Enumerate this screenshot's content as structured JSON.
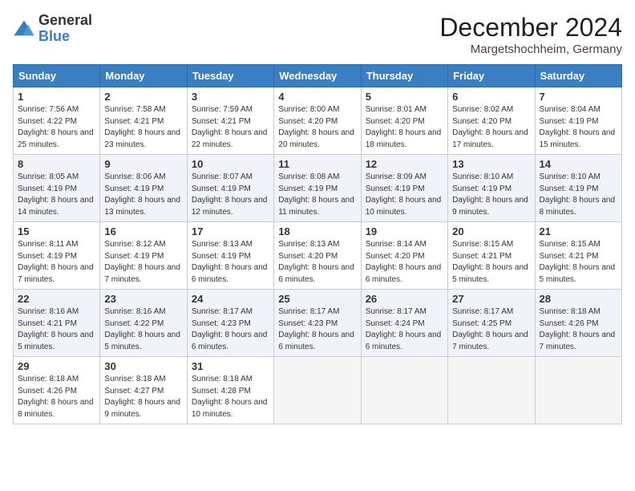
{
  "header": {
    "logo": {
      "general": "General",
      "blue": "Blue"
    },
    "title": "December 2024",
    "location": "Margetshochheim, Germany"
  },
  "days_of_week": [
    "Sunday",
    "Monday",
    "Tuesday",
    "Wednesday",
    "Thursday",
    "Friday",
    "Saturday"
  ],
  "weeks": [
    [
      {
        "num": "1",
        "sunrise": "7:56 AM",
        "sunset": "4:22 PM",
        "daylight": "8 hours and 25 minutes."
      },
      {
        "num": "2",
        "sunrise": "7:58 AM",
        "sunset": "4:21 PM",
        "daylight": "8 hours and 23 minutes."
      },
      {
        "num": "3",
        "sunrise": "7:59 AM",
        "sunset": "4:21 PM",
        "daylight": "8 hours and 22 minutes."
      },
      {
        "num": "4",
        "sunrise": "8:00 AM",
        "sunset": "4:20 PM",
        "daylight": "8 hours and 20 minutes."
      },
      {
        "num": "5",
        "sunrise": "8:01 AM",
        "sunset": "4:20 PM",
        "daylight": "8 hours and 18 minutes."
      },
      {
        "num": "6",
        "sunrise": "8:02 AM",
        "sunset": "4:20 PM",
        "daylight": "8 hours and 17 minutes."
      },
      {
        "num": "7",
        "sunrise": "8:04 AM",
        "sunset": "4:19 PM",
        "daylight": "8 hours and 15 minutes."
      }
    ],
    [
      {
        "num": "8",
        "sunrise": "8:05 AM",
        "sunset": "4:19 PM",
        "daylight": "8 hours and 14 minutes."
      },
      {
        "num": "9",
        "sunrise": "8:06 AM",
        "sunset": "4:19 PM",
        "daylight": "8 hours and 13 minutes."
      },
      {
        "num": "10",
        "sunrise": "8:07 AM",
        "sunset": "4:19 PM",
        "daylight": "8 hours and 12 minutes."
      },
      {
        "num": "11",
        "sunrise": "8:08 AM",
        "sunset": "4:19 PM",
        "daylight": "8 hours and 11 minutes."
      },
      {
        "num": "12",
        "sunrise": "8:09 AM",
        "sunset": "4:19 PM",
        "daylight": "8 hours and 10 minutes."
      },
      {
        "num": "13",
        "sunrise": "8:10 AM",
        "sunset": "4:19 PM",
        "daylight": "8 hours and 9 minutes."
      },
      {
        "num": "14",
        "sunrise": "8:10 AM",
        "sunset": "4:19 PM",
        "daylight": "8 hours and 8 minutes."
      }
    ],
    [
      {
        "num": "15",
        "sunrise": "8:11 AM",
        "sunset": "4:19 PM",
        "daylight": "8 hours and 7 minutes."
      },
      {
        "num": "16",
        "sunrise": "8:12 AM",
        "sunset": "4:19 PM",
        "daylight": "8 hours and 7 minutes."
      },
      {
        "num": "17",
        "sunrise": "8:13 AM",
        "sunset": "4:19 PM",
        "daylight": "8 hours and 6 minutes."
      },
      {
        "num": "18",
        "sunrise": "8:13 AM",
        "sunset": "4:20 PM",
        "daylight": "8 hours and 6 minutes."
      },
      {
        "num": "19",
        "sunrise": "8:14 AM",
        "sunset": "4:20 PM",
        "daylight": "8 hours and 6 minutes."
      },
      {
        "num": "20",
        "sunrise": "8:15 AM",
        "sunset": "4:21 PM",
        "daylight": "8 hours and 5 minutes."
      },
      {
        "num": "21",
        "sunrise": "8:15 AM",
        "sunset": "4:21 PM",
        "daylight": "8 hours and 5 minutes."
      }
    ],
    [
      {
        "num": "22",
        "sunrise": "8:16 AM",
        "sunset": "4:21 PM",
        "daylight": "8 hours and 5 minutes."
      },
      {
        "num": "23",
        "sunrise": "8:16 AM",
        "sunset": "4:22 PM",
        "daylight": "8 hours and 5 minutes."
      },
      {
        "num": "24",
        "sunrise": "8:17 AM",
        "sunset": "4:23 PM",
        "daylight": "8 hours and 6 minutes."
      },
      {
        "num": "25",
        "sunrise": "8:17 AM",
        "sunset": "4:23 PM",
        "daylight": "8 hours and 6 minutes."
      },
      {
        "num": "26",
        "sunrise": "8:17 AM",
        "sunset": "4:24 PM",
        "daylight": "8 hours and 6 minutes."
      },
      {
        "num": "27",
        "sunrise": "8:17 AM",
        "sunset": "4:25 PM",
        "daylight": "8 hours and 7 minutes."
      },
      {
        "num": "28",
        "sunrise": "8:18 AM",
        "sunset": "4:26 PM",
        "daylight": "8 hours and 7 minutes."
      }
    ],
    [
      {
        "num": "29",
        "sunrise": "8:18 AM",
        "sunset": "4:26 PM",
        "daylight": "8 hours and 8 minutes."
      },
      {
        "num": "30",
        "sunrise": "8:18 AM",
        "sunset": "4:27 PM",
        "daylight": "8 hours and 9 minutes."
      },
      {
        "num": "31",
        "sunrise": "8:18 AM",
        "sunset": "4:28 PM",
        "daylight": "8 hours and 10 minutes."
      },
      null,
      null,
      null,
      null
    ]
  ],
  "labels": {
    "sunrise": "Sunrise:",
    "sunset": "Sunset:",
    "daylight": "Daylight:"
  }
}
